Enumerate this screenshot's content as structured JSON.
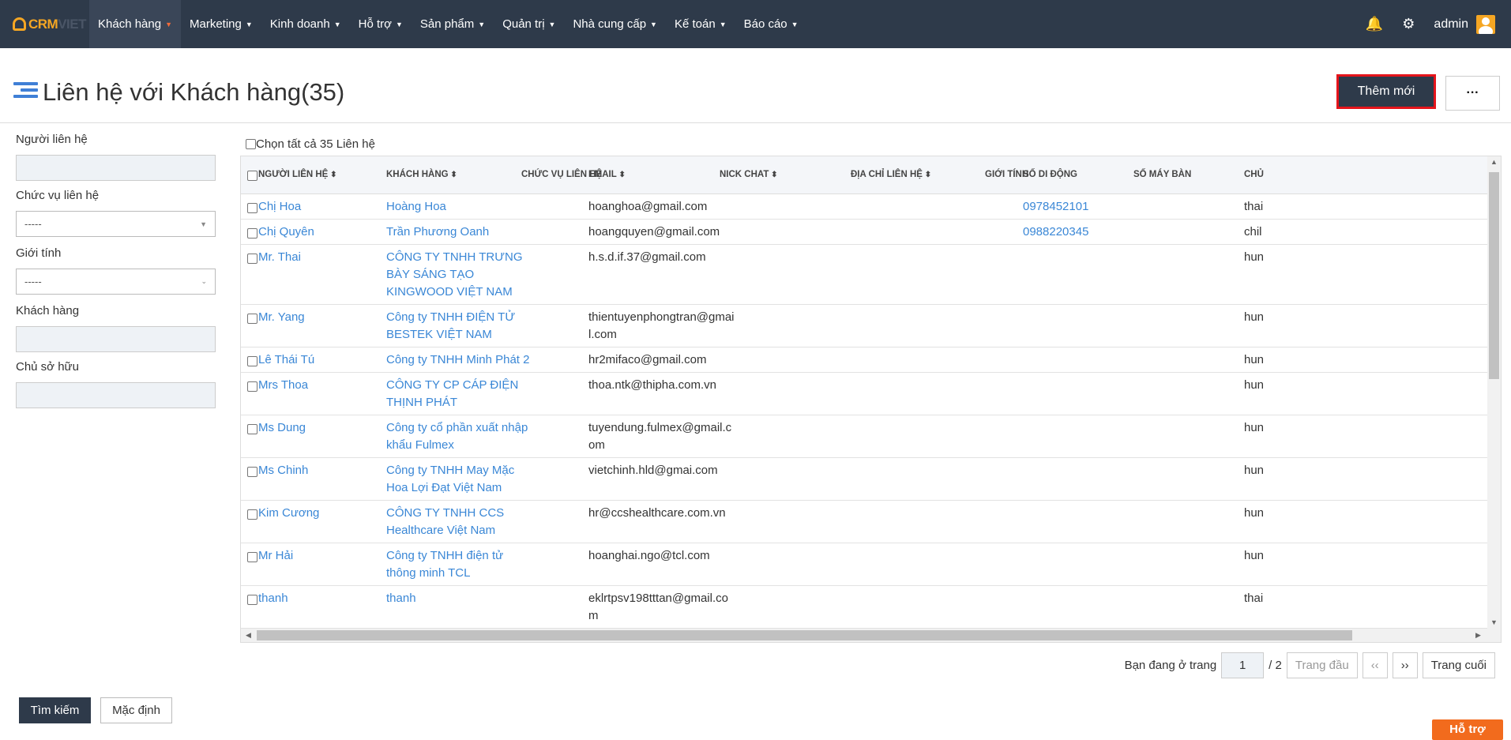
{
  "nav": {
    "logo_crm": "CRM",
    "logo_viet": "VIET",
    "items": [
      "Khách hàng",
      "Marketing",
      "Kinh doanh",
      "Hỗ trợ",
      "Sản phẩm",
      "Quản trị",
      "Nhà cung cấp",
      "Kế toán",
      "Báo cáo"
    ],
    "user": "admin",
    "accent": "#f5a623"
  },
  "page": {
    "title": "Liên hệ với Khách hàng(35)",
    "add_button": "Thêm mới",
    "more_button": "···"
  },
  "filters": {
    "contact_label": "Người liên hệ",
    "position_label": "Chức vụ liên hệ",
    "position_value": "-----",
    "gender_label": "Giới tính",
    "gender_value": "-----",
    "customer_label": "Khách hàng",
    "owner_label": "Chủ sở hữu",
    "search_button": "Tìm kiếm",
    "default_button": "Mặc định"
  },
  "table": {
    "select_all": "Chọn tất cả 35 Liên hệ",
    "headers": [
      "NGƯỜI LIÊN HỆ",
      "KHÁCH HÀNG",
      "CHỨC VỤ LIÊN HỆ",
      "EMAIL",
      "NICK CHAT",
      "ĐỊA CHỈ LIÊN HỆ",
      "GIỚI TÍNH",
      "SỐ DI ĐỘNG",
      "SỐ MÁY BÀN",
      "CHỦ"
    ],
    "rows": [
      {
        "contact": "Chị Hoa",
        "customer": [
          "Hoàng Hoa"
        ],
        "email": [
          "hoanghoa@gmail.com"
        ],
        "mobile": "0978452101",
        "owner": "thai"
      },
      {
        "contact": "Chị Quyên",
        "customer": [
          "Trần Phương Oanh"
        ],
        "email": [
          "hoangquyen@gmail.com"
        ],
        "mobile": "0988220345",
        "owner": "chil"
      },
      {
        "contact": "Mr. Thai",
        "customer": [
          "CÔNG TY TNHH TRƯNG",
          "BÀY SÁNG TẠO",
          "KINGWOOD VIỆT NAM"
        ],
        "email": [
          "h.s.d.if.37@gmail.com"
        ],
        "mobile": "",
        "owner": "hun"
      },
      {
        "contact": "Mr. Yang",
        "customer": [
          "Công ty TNHH ĐIỆN TỬ",
          "BESTEK VIỆT NAM"
        ],
        "email": [
          "thientuyenphongtran@gmai",
          "l.com"
        ],
        "mobile": "",
        "owner": "hun"
      },
      {
        "contact": "Lê Thái Tú",
        "customer": [
          "Công ty TNHH Minh Phát 2"
        ],
        "email": [
          "hr2mifaco@gmail.com"
        ],
        "mobile": "",
        "owner": "hun"
      },
      {
        "contact": "Mrs Thoa",
        "customer": [
          "CÔNG TY CP CÁP ĐIỆN",
          "THỊNH PHÁT"
        ],
        "email": [
          "thoa.ntk@thipha.com.vn"
        ],
        "mobile": "",
        "owner": "hun"
      },
      {
        "contact": "Ms Dung",
        "customer": [
          "Công ty cổ phần xuất nhập",
          "khẩu Fulmex"
        ],
        "email": [
          "tuyendung.fulmex@gmail.c",
          "om"
        ],
        "mobile": "",
        "owner": "hun"
      },
      {
        "contact": "Ms Chinh",
        "customer": [
          "Công ty TNHH May Mặc",
          "Hoa Lợi Đạt Việt Nam"
        ],
        "email": [
          "vietchinh.hld@gmai.com"
        ],
        "mobile": "",
        "owner": "hun"
      },
      {
        "contact": "Kim Cương",
        "customer": [
          "CÔNG TY TNHH CCS",
          "Healthcare Việt Nam"
        ],
        "email": [
          "hr@ccshealthcare.com.vn"
        ],
        "mobile": "",
        "owner": "hun"
      },
      {
        "contact": "Mr Hải",
        "customer": [
          "Công ty TNHH điện tử",
          "thông minh TCL"
        ],
        "email": [
          "hoanghai.ngo@tcl.com"
        ],
        "mobile": "",
        "owner": "hun"
      },
      {
        "contact": "thanh",
        "customer": [
          "thanh"
        ],
        "email": [
          "eklrtpsv198tttan@gmail.co",
          "m"
        ],
        "mobile": "",
        "owner": "thai"
      }
    ]
  },
  "pager": {
    "label": "Bạn đang ở trang",
    "current": "1",
    "total": "/ 2",
    "first": "Trang đầu",
    "prev": "‹‹",
    "next": "››",
    "last": "Trang cuối"
  },
  "help": "Hỗ trợ"
}
